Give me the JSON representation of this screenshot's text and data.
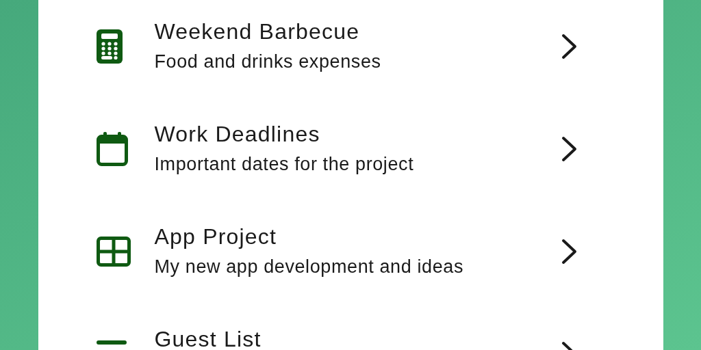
{
  "items": [
    {
      "title": "Weekend Barbecue",
      "subtitle": "Food and drinks expenses"
    },
    {
      "title": "Work Deadlines",
      "subtitle": "Important dates for the project"
    },
    {
      "title": "App Project",
      "subtitle": "My new app development and ideas"
    },
    {
      "title": "Guest List"
    }
  ]
}
